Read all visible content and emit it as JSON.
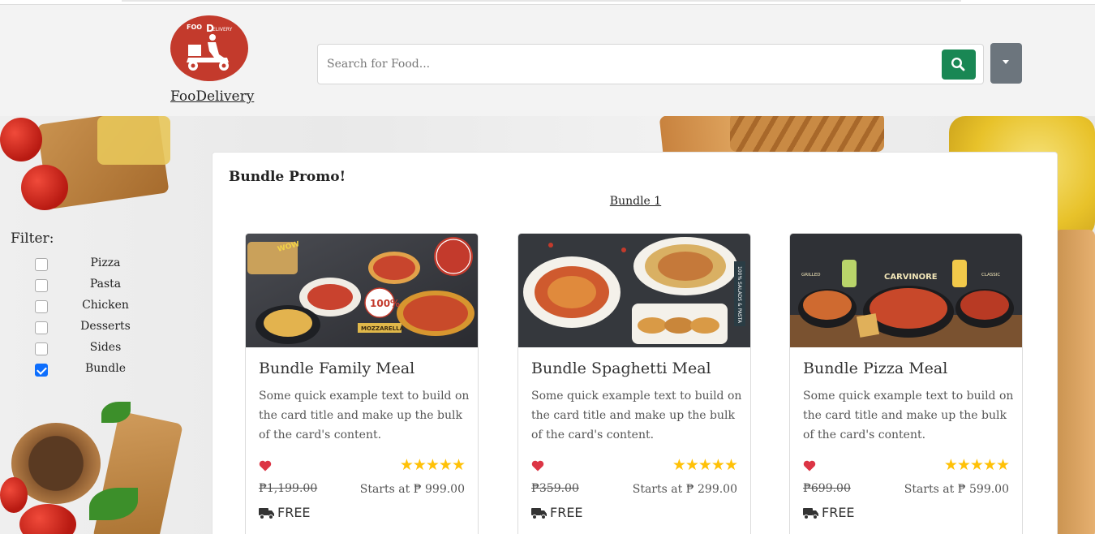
{
  "brand": {
    "name": "FooDelivery",
    "logo_text": "FOODELIVERY"
  },
  "search": {
    "placeholder": "Search for Food..."
  },
  "icons": {
    "search": "search-icon",
    "dropdown": "caret-down-icon",
    "heart": "heart-icon",
    "star": "star-icon",
    "truck": "truck-icon"
  },
  "colors": {
    "search_button": "#198754",
    "dropdown_button": "#6c757d",
    "logo_bg": "#c33a2c",
    "star": "#ffc107",
    "heart": "#dc3545",
    "checkbox_checked": "#0d6efd"
  },
  "filter": {
    "title": "Filter:",
    "items": [
      {
        "label": "Pizza",
        "checked": false
      },
      {
        "label": "Pasta",
        "checked": false
      },
      {
        "label": "Chicken",
        "checked": false
      },
      {
        "label": "Desserts",
        "checked": false
      },
      {
        "label": "Sides",
        "checked": false
      },
      {
        "label": "Bundle",
        "checked": true
      }
    ]
  },
  "main": {
    "title": "Bundle Promo!",
    "subtitle": "Bundle 1",
    "cards": [
      {
        "title": "Bundle Family Meal",
        "text": "Some quick example text to build on the card title and make up the bulk of the card's content.",
        "rating": 5,
        "stars": "★★★★★",
        "old_price": "₱1,199.00",
        "price": "Starts at ₱ 999.00",
        "delivery": "FREE"
      },
      {
        "title": "Bundle Spaghetti Meal",
        "text": "Some quick example text to build on the card title and make up the bulk of the card's content.",
        "rating": 5,
        "stars": "★★★★★",
        "old_price": "₱359.00",
        "price": "Starts at ₱ 299.00",
        "delivery": "FREE"
      },
      {
        "title": "Bundle Pizza Meal",
        "text": "Some quick example text to build on the card title and make up the bulk of the card's content.",
        "rating": 5,
        "stars": "★★★★★",
        "old_price": "₱699.00",
        "price": "Starts at ₱ 599.00",
        "delivery": "FREE"
      }
    ]
  }
}
